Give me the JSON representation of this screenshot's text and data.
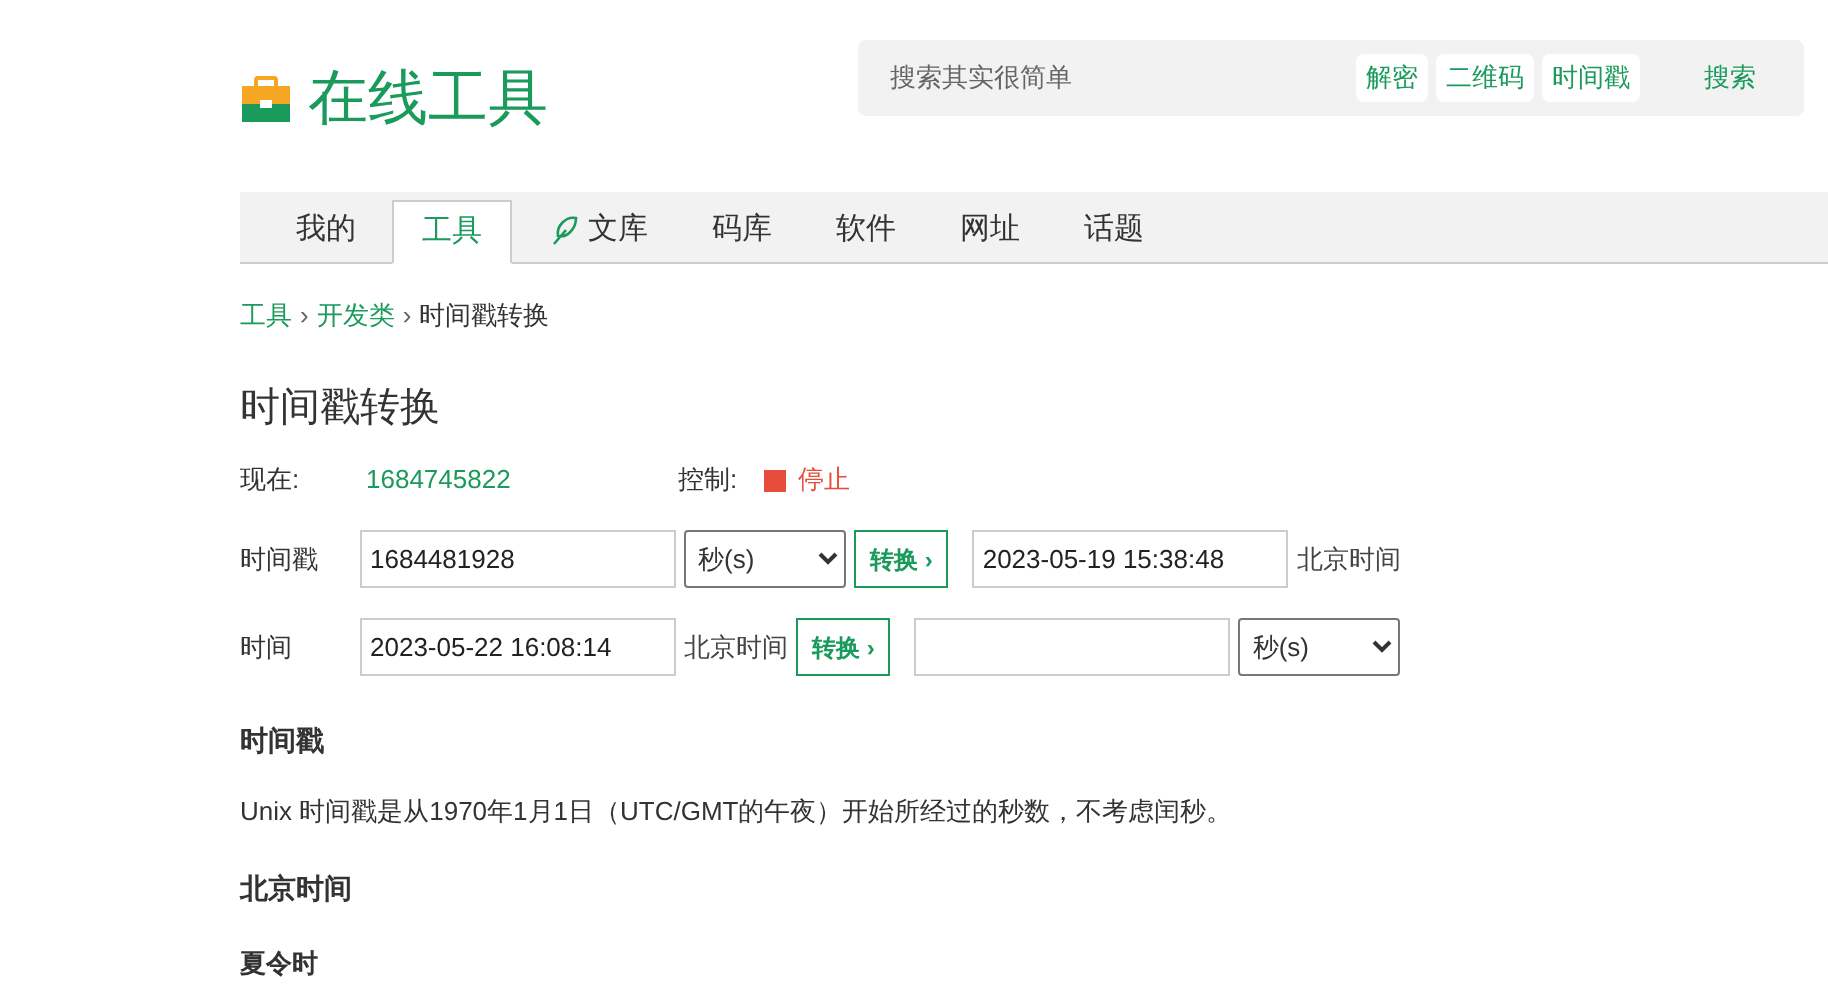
{
  "logo": {
    "text": "在线工具"
  },
  "search": {
    "placeholder": "搜索其实很简单",
    "tags": [
      "解密",
      "二维码",
      "时间戳"
    ],
    "button": "搜索"
  },
  "nav": [
    {
      "label": "我的",
      "selected": false,
      "kind": "plain"
    },
    {
      "label": "工具",
      "selected": true,
      "kind": "plain"
    },
    {
      "label": "文库",
      "selected": false,
      "kind": "icon"
    },
    {
      "label": "码库",
      "selected": false,
      "kind": "plain"
    },
    {
      "label": "软件",
      "selected": false,
      "kind": "plain"
    },
    {
      "label": "网址",
      "selected": false,
      "kind": "plain"
    },
    {
      "label": "话题",
      "selected": false,
      "kind": "plain"
    }
  ],
  "breadcrumb": [
    {
      "label": "工具",
      "kind": "link"
    },
    {
      "label": "›",
      "kind": "separator"
    },
    {
      "label": "开发类",
      "kind": "link"
    },
    {
      "label": "›",
      "kind": "separator"
    },
    {
      "label": "时间戳转换",
      "kind": "current"
    }
  ],
  "title": "时间戳转换",
  "now": {
    "label": "现在:",
    "value": "1684745822"
  },
  "control": {
    "label": "控制:",
    "action": "停止"
  },
  "converters": [
    {
      "label": "时间戳",
      "parts": [
        {
          "kind": "field",
          "value": "1684481928"
        },
        {
          "kind": "select",
          "value": "秒(s)"
        },
        {
          "kind": "button",
          "value": "转换 ›"
        },
        {
          "kind": "field",
          "value": "2023-05-19 15:38:48"
        },
        {
          "kind": "text",
          "value": "北京时间"
        }
      ]
    },
    {
      "label": "时间",
      "parts": [
        {
          "kind": "field",
          "value": "2023-05-22 16:08:14"
        },
        {
          "kind": "text",
          "value": "北京时间"
        },
        {
          "kind": "button",
          "value": "转换 ›"
        },
        {
          "kind": "field"
        },
        {
          "kind": "select",
          "value": "秒(s)"
        }
      ]
    }
  ],
  "sections": [
    {
      "kind": "heading",
      "text": "时间戳"
    },
    {
      "kind": "paragraph",
      "text": "Unix 时间戳是从1970年1月1日（UTC/GMT的午夜）开始所经过的秒数，不考虑闰秒。"
    },
    {
      "kind": "heading",
      "text": "北京时间"
    },
    {
      "kind": "subheading",
      "text": "夏令时"
    }
  ]
}
